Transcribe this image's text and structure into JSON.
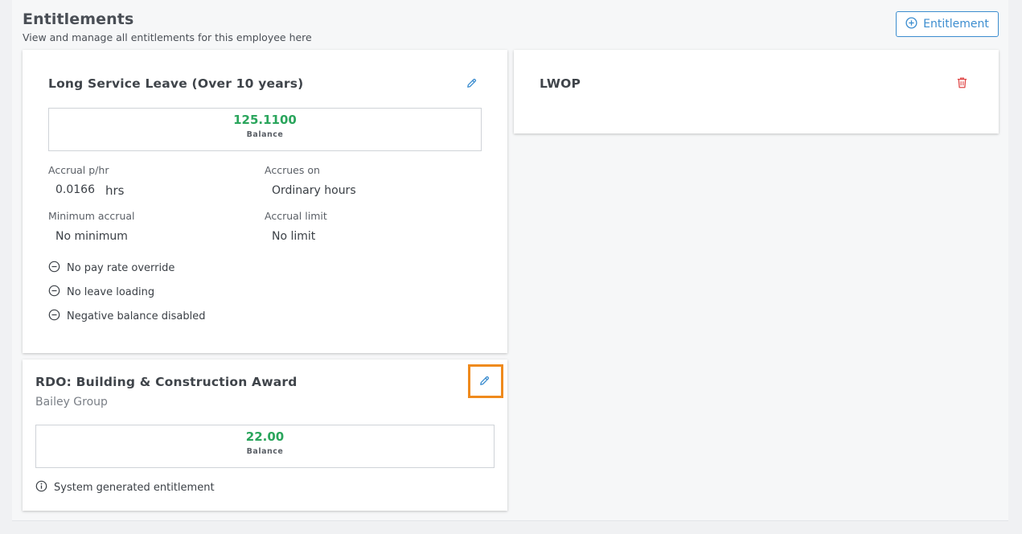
{
  "header": {
    "title": "Entitlements",
    "subtitle": "View and manage all entitlements for this employee here",
    "add_button_label": "Entitlement"
  },
  "cards": [
    {
      "title": "Long Service Leave (Over 10 years)",
      "balance_value": "125.1100",
      "balance_label": "Balance",
      "fields": {
        "accrual_label": "Accrual p/hr",
        "accrual_value": "0.0166",
        "accrual_unit": "hrs",
        "accrues_on_label": "Accrues on",
        "accrues_on_value": "Ordinary hours",
        "min_accrual_label": "Minimum accrual",
        "min_accrual_value": "No minimum",
        "accrual_limit_label": "Accrual limit",
        "accrual_limit_value": "No limit"
      },
      "flags": [
        "No pay rate override",
        "No leave loading",
        "Negative balance disabled"
      ]
    },
    {
      "title": "LWOP"
    },
    {
      "title": "RDO: Building & Construction Award",
      "subtitle": "Bailey Group",
      "balance_value": "22.00",
      "balance_label": "Balance",
      "note": "System generated entitlement"
    }
  ],
  "colors": {
    "accent": "#3c8dcf",
    "balance_green": "#2aa55c",
    "delete_red": "#e04a4a",
    "highlight_orange": "#ef8a1c"
  },
  "icons": {
    "edit": "pencil-icon",
    "delete": "trash-icon",
    "add": "plus-circle-icon",
    "flag": "minus-circle-icon",
    "info": "info-icon"
  }
}
